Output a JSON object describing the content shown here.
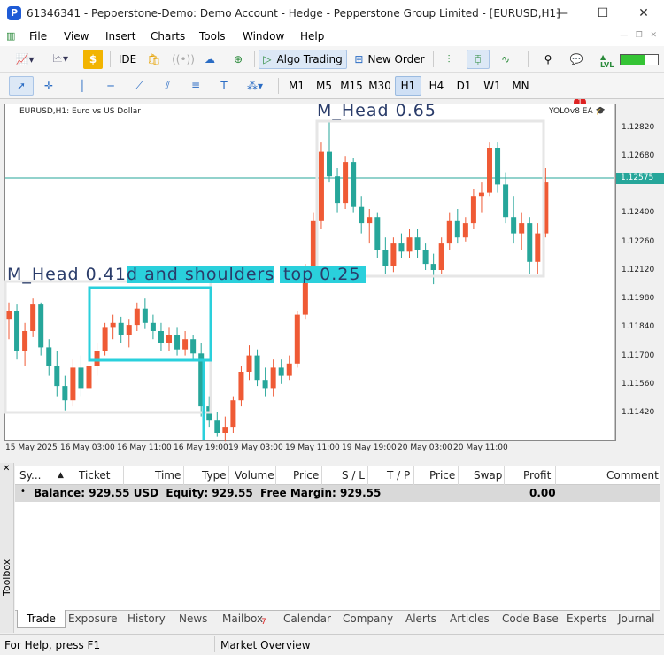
{
  "window": {
    "title": "61346341 - Pepperstone-Demo: Demo Account - Hedge - Pepperstone Group Limited - [EURUSD,H1]",
    "controls": [
      "—",
      "☐",
      "✕"
    ]
  },
  "menu": [
    "File",
    "View",
    "Insert",
    "Charts",
    "Tools",
    "Window",
    "Help"
  ],
  "toolbar": {
    "ide_label": "IDE",
    "algo_trading_label": "Algo Trading",
    "new_order_label": "New Order",
    "notification_count": "1",
    "lvl_label": "LVL"
  },
  "timeframes": [
    "M1",
    "M5",
    "M15",
    "M30",
    "H1",
    "H4",
    "D1",
    "W1",
    "MN"
  ],
  "active_timeframe": "H1",
  "chart": {
    "symbol_line": "EURUSD,H1: Euro vs US Dollar",
    "ea_label": "YOLOv8 EA",
    "current_price": "1.12575",
    "price_labels": [
      "1.12820",
      "1.12680",
      "1.12400",
      "1.12260",
      "1.12120",
      "1.11980",
      "1.11840",
      "1.11700",
      "1.11560",
      "1.11420"
    ],
    "time_labels": [
      "15 May 2025",
      "16 May 03:00",
      "16 May 11:00",
      "16 May 19:00",
      "19 May 03:00",
      "19 May 11:00",
      "19 May 19:00",
      "20 May 03:00",
      "20 May 11:00"
    ],
    "detection_labels": [
      "M_Head 0.65",
      "M_Head 0.41",
      "d and shoulders",
      "top 0.25"
    ],
    "colors": {
      "bull": "#ef5a35",
      "bear": "#26a69a",
      "box": "#2ad0dc",
      "hline": "#26a69a"
    }
  },
  "terminal": {
    "columns": [
      "Sy...",
      "▲",
      "Ticket",
      "Time",
      "Type",
      "Volume",
      "Price",
      "S / L",
      "T / P",
      "Price",
      "Swap",
      "Profit",
      "Comment"
    ],
    "balance_text": "Balance: 929.55 USD  Equity: 929.55  Free Margin: 929.55",
    "profit": "0.00",
    "tabs": [
      "Trade",
      "Exposure",
      "History",
      "News",
      "Mailbox",
      "Calendar",
      "Company",
      "Alerts",
      "Articles",
      "Code Base",
      "Experts",
      "Journal"
    ],
    "mailbox_count": "7",
    "toolbox_label": "Toolbox"
  },
  "status": {
    "help": "For Help, press F1",
    "profile": "Market Overview"
  }
}
